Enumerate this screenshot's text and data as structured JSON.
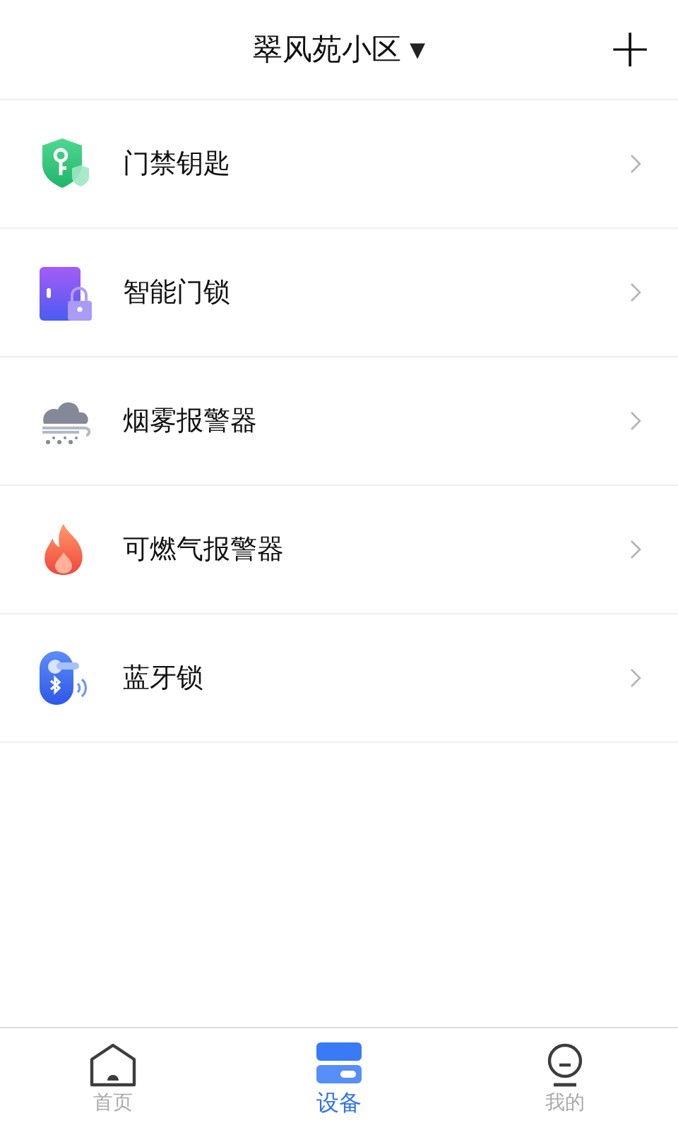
{
  "header": {
    "title": "翠风苑小区",
    "dropdown": "▾",
    "add_button": "+"
  },
  "devices": [
    {
      "kind": "access",
      "name": "门禁钥匙"
    },
    {
      "kind": "doorlock",
      "name": "智能门锁"
    },
    {
      "kind": "smoke",
      "name": "烟雾报警器"
    },
    {
      "kind": "gas",
      "name": "可燃气报警器"
    },
    {
      "kind": "bluetooth",
      "name": "蓝牙锁"
    }
  ],
  "tabs": [
    {
      "kind": "home",
      "label": "首页",
      "selected": false
    },
    {
      "kind": "devices",
      "label": "设备",
      "selected": true
    },
    {
      "kind": "me",
      "label": "我的",
      "selected": false
    }
  ]
}
